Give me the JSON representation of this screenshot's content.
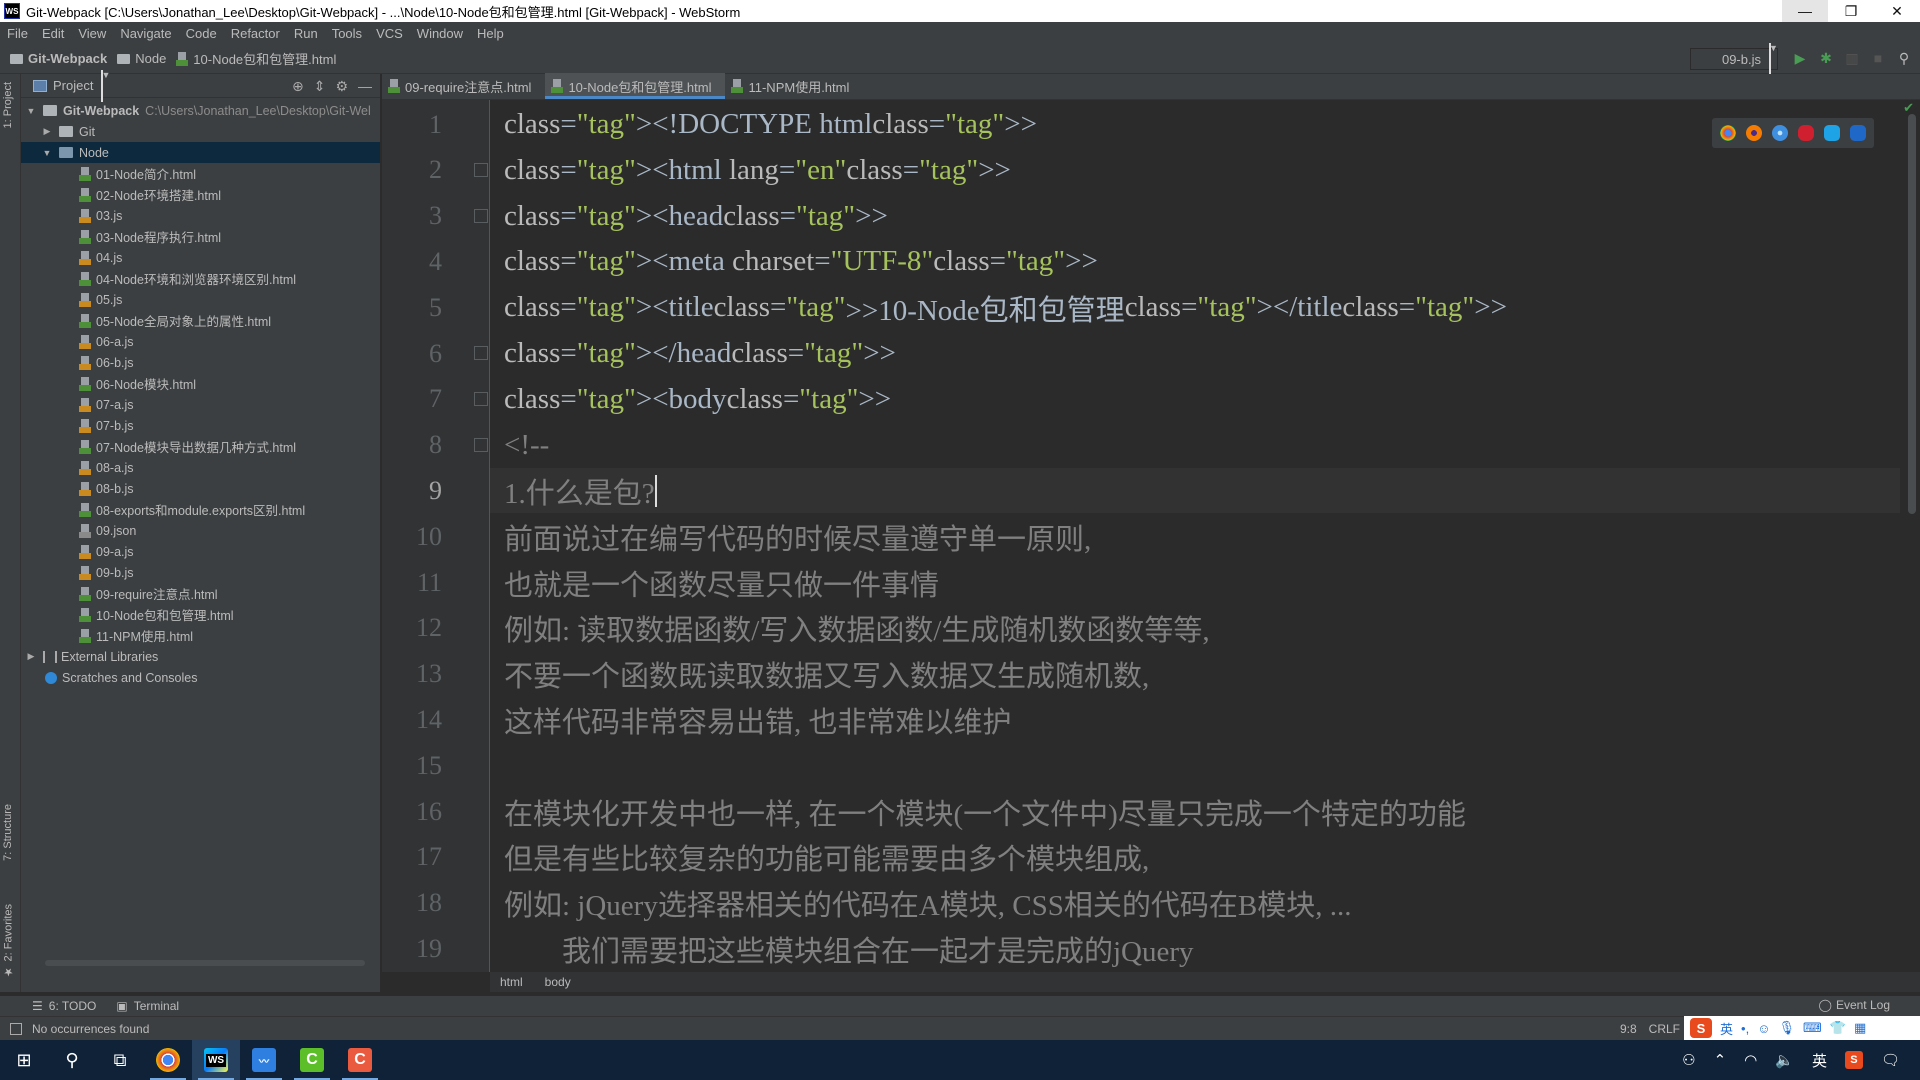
{
  "window": {
    "title": "Git-Webpack [C:\\Users\\Jonathan_Lee\\Desktop\\Git-Webpack] - ...\\Node\\10-Node包和包管理.html [Git-Webpack] - WebStorm",
    "app_icon": "WS",
    "minimize": "—",
    "maximize": "❐",
    "close": "✕"
  },
  "menu": [
    "File",
    "Edit",
    "View",
    "Navigate",
    "Code",
    "Refactor",
    "Run",
    "Tools",
    "VCS",
    "Window",
    "Help"
  ],
  "navbar": {
    "crumbs": [
      "Git-Webpack",
      "Node",
      "10-Node包和包管理.html"
    ],
    "run_config": "09-b.js"
  },
  "left_strip": {
    "project_tab": "1: Project",
    "structure_tab": "7: Structure",
    "favorites_tab": "2: Favorites"
  },
  "project_panel": {
    "title": "Project",
    "root": {
      "name": "Git-Webpack",
      "path": "C:\\Users\\Jonathan_Lee\\Desktop\\Git-Wel"
    },
    "git_folder": "Git",
    "node_folder": "Node",
    "files": [
      {
        "name": "01-Node简介.html",
        "type": "html"
      },
      {
        "name": "02-Node环境搭建.html",
        "type": "html"
      },
      {
        "name": "03.js",
        "type": "js"
      },
      {
        "name": "03-Node程序执行.html",
        "type": "html"
      },
      {
        "name": "04.js",
        "type": "js"
      },
      {
        "name": "04-Node环境和浏览器环境区别.html",
        "type": "html"
      },
      {
        "name": "05.js",
        "type": "js"
      },
      {
        "name": "05-Node全局对象上的属性.html",
        "type": "html"
      },
      {
        "name": "06-a.js",
        "type": "js"
      },
      {
        "name": "06-b.js",
        "type": "js"
      },
      {
        "name": "06-Node模块.html",
        "type": "html"
      },
      {
        "name": "07-a.js",
        "type": "js"
      },
      {
        "name": "07-b.js",
        "type": "js"
      },
      {
        "name": "07-Node模块导出数据几种方式.html",
        "type": "html"
      },
      {
        "name": "08-a.js",
        "type": "js"
      },
      {
        "name": "08-b.js",
        "type": "js"
      },
      {
        "name": "08-exports和module.exports区别.html",
        "type": "html"
      },
      {
        "name": "09.json",
        "type": "json"
      },
      {
        "name": "09-a.js",
        "type": "js"
      },
      {
        "name": "09-b.js",
        "type": "js"
      },
      {
        "name": "09-require注意点.html",
        "type": "html"
      },
      {
        "name": "10-Node包和包管理.html",
        "type": "html"
      },
      {
        "name": "11-NPM使用.html",
        "type": "html"
      }
    ],
    "external_libraries": "External Libraries",
    "scratches": "Scratches and Consoles"
  },
  "editor_tabs": [
    {
      "label": "09-require注意点.html",
      "active": false
    },
    {
      "label": "10-Node包和包管理.html",
      "active": true
    },
    {
      "label": "11-NPM使用.html",
      "active": false
    }
  ],
  "editor": {
    "current_line": 9,
    "lines": [
      {
        "n": "1",
        "text": "<!DOCTYPE html>"
      },
      {
        "n": "2",
        "text": "<html lang=\"en\">"
      },
      {
        "n": "3",
        "text": "<head>"
      },
      {
        "n": "4",
        "text": "    <meta charset=\"UTF-8\">"
      },
      {
        "n": "5",
        "text": "    <title>10-Node包和包管理</title>"
      },
      {
        "n": "6",
        "text": "</head>"
      },
      {
        "n": "7",
        "text": "<body>"
      },
      {
        "n": "8",
        "text": "<!--"
      },
      {
        "n": "9",
        "text": "1.什么是包?"
      },
      {
        "n": "10",
        "text": "前面说过在编写代码的时候尽量遵守单一原则,"
      },
      {
        "n": "11",
        "text": "也就是一个函数尽量只做一件事情"
      },
      {
        "n": "12",
        "text": "例如: 读取数据函数/写入数据函数/生成随机数函数等等,"
      },
      {
        "n": "13",
        "text": "不要一个函数既读取数据又写入数据又生成随机数,"
      },
      {
        "n": "14",
        "text": "这样代码非常容易出错, 也非常难以维护"
      },
      {
        "n": "15",
        "text": ""
      },
      {
        "n": "16",
        "text": "在模块化开发中也一样, 在一个模块(一个文件中)尽量只完成一个特定的功能"
      },
      {
        "n": "17",
        "text": "但是有些比较复杂的功能可能需要由多个模块组成,"
      },
      {
        "n": "18",
        "text": "例如: jQuery选择器相关的代码在A模块, CSS相关的代码在B模块, ..."
      },
      {
        "n": "19",
        "text": "        我们需要把这些模块组合在一起才是完成的jQuery"
      }
    ]
  },
  "breadcrumb": [
    "html",
    "body"
  ],
  "tool_windows": {
    "todo": "6: TODO",
    "terminal": "Terminal",
    "event_log": "Event Log"
  },
  "status": {
    "message": "No occurrences found",
    "position": "9:8",
    "line_sep": "CRLF"
  },
  "ime": {
    "logo": "S",
    "lang": "英",
    "punct": "•,"
  },
  "taskbar": {
    "tray_lang": "英",
    "apps": [
      "Chrome",
      "WebStorm",
      "Audio Editor",
      "Camtasia Green",
      "Camtasia Red"
    ]
  }
}
